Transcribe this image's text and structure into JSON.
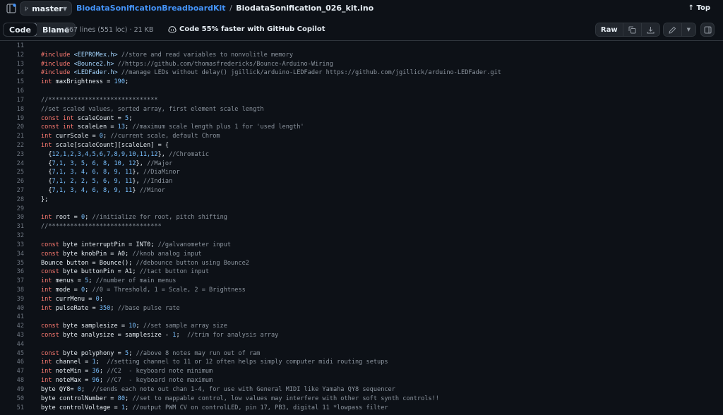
{
  "header": {
    "branch": "master",
    "repo": "BiodataSonificationBreadboardKit",
    "separator": "/",
    "file": "BiodataSonification_026_kit.ino",
    "top_label": "Top"
  },
  "toolbar": {
    "code_tab": "Code",
    "blame_tab": "Blame",
    "file_meta": "667 lines (551 loc) · 21 KB",
    "copilot_text": "Code 55% faster with GitHub Copilot",
    "raw_label": "Raw"
  },
  "code_lines": [
    {
      "n": "11",
      "t": []
    },
    {
      "n": "12",
      "t": [
        [
          "kw",
          "#include "
        ],
        [
          "str",
          "<EEPROMex.h>"
        ],
        [
          "com",
          " //store and read variables to nonvolitle memory"
        ]
      ]
    },
    {
      "n": "13",
      "t": [
        [
          "kw",
          "#include "
        ],
        [
          "str",
          "<Bounce2.h>"
        ],
        [
          "com",
          " //https://github.com/thomasfredericks/Bounce-Arduino-Wiring"
        ]
      ]
    },
    {
      "n": "14",
      "t": [
        [
          "kw",
          "#include "
        ],
        [
          "str",
          "<LEDFader.h>"
        ],
        [
          "com",
          " //manage LEDs without delay() jgillick/arduino-LEDFader https://github.com/jgillick/arduino-LEDFader.git"
        ]
      ]
    },
    {
      "n": "15",
      "t": [
        [
          "kw",
          "int"
        ],
        [
          "p",
          " maxBrightness = "
        ],
        [
          "num",
          "190"
        ],
        [
          "p",
          ";"
        ]
      ]
    },
    {
      "n": "16",
      "t": []
    },
    {
      "n": "17",
      "t": [
        [
          "com",
          "//******************************"
        ]
      ]
    },
    {
      "n": "18",
      "t": [
        [
          "com",
          "//set scaled values, sorted array, first element scale length"
        ]
      ]
    },
    {
      "n": "19",
      "t": [
        [
          "kw",
          "const int"
        ],
        [
          "p",
          " scaleCount = "
        ],
        [
          "num",
          "5"
        ],
        [
          "p",
          ";"
        ]
      ]
    },
    {
      "n": "20",
      "t": [
        [
          "kw",
          "const int"
        ],
        [
          "p",
          " scaleLen = "
        ],
        [
          "num",
          "13"
        ],
        [
          "p",
          "; "
        ],
        [
          "com",
          "//maximum scale length plus 1 for 'used length'"
        ]
      ]
    },
    {
      "n": "21",
      "t": [
        [
          "kw",
          "int"
        ],
        [
          "p",
          " currScale = "
        ],
        [
          "num",
          "0"
        ],
        [
          "p",
          "; "
        ],
        [
          "com",
          "//current scale, default Chrom"
        ]
      ]
    },
    {
      "n": "22",
      "t": [
        [
          "kw",
          "int"
        ],
        [
          "p",
          " scale[scaleCount][scaleLen] = {"
        ]
      ]
    },
    {
      "n": "23",
      "t": [
        [
          "p",
          "  {"
        ],
        [
          "num",
          "12,1,2,3,4,5,6,7,8,9,10,11,12"
        ],
        [
          "p",
          "}, "
        ],
        [
          "com",
          "//Chromatic"
        ]
      ]
    },
    {
      "n": "24",
      "t": [
        [
          "p",
          "  {"
        ],
        [
          "num",
          "7,1, 3, 5, 6, 8, 10, 12"
        ],
        [
          "p",
          "}, "
        ],
        [
          "com",
          "//Major"
        ]
      ]
    },
    {
      "n": "25",
      "t": [
        [
          "p",
          "  {"
        ],
        [
          "num",
          "7,1, 3, 4, 6, 8, 9, 11"
        ],
        [
          "p",
          "}, "
        ],
        [
          "com",
          "//DiaMinor"
        ]
      ]
    },
    {
      "n": "26",
      "t": [
        [
          "p",
          "  {"
        ],
        [
          "num",
          "7,1, 2, 2, 5, 6, 9, 11"
        ],
        [
          "p",
          "}, "
        ],
        [
          "com",
          "//Indian"
        ]
      ]
    },
    {
      "n": "27",
      "t": [
        [
          "p",
          "  {"
        ],
        [
          "num",
          "7,1, 3, 4, 6, 8, 9, 11"
        ],
        [
          "p",
          "} "
        ],
        [
          "com",
          "//Minor"
        ]
      ]
    },
    {
      "n": "28",
      "t": [
        [
          "p",
          "};"
        ]
      ]
    },
    {
      "n": "29",
      "t": []
    },
    {
      "n": "30",
      "t": [
        [
          "kw",
          "int"
        ],
        [
          "p",
          " root = "
        ],
        [
          "num",
          "0"
        ],
        [
          "p",
          "; "
        ],
        [
          "com",
          "//initialize for root, pitch shifting"
        ]
      ]
    },
    {
      "n": "31",
      "t": [
        [
          "com",
          "//*******************************"
        ]
      ]
    },
    {
      "n": "32",
      "t": []
    },
    {
      "n": "33",
      "t": [
        [
          "kw",
          "const"
        ],
        [
          "p",
          " byte interruptPin = INT0; "
        ],
        [
          "com",
          "//galvanometer input"
        ]
      ]
    },
    {
      "n": "34",
      "t": [
        [
          "kw",
          "const"
        ],
        [
          "p",
          " byte knobPin = A0; "
        ],
        [
          "com",
          "//knob analog input"
        ]
      ]
    },
    {
      "n": "35",
      "t": [
        [
          "p",
          "Bounce button = Bounce(); "
        ],
        [
          "com",
          "//debounce button using Bounce2"
        ]
      ]
    },
    {
      "n": "36",
      "t": [
        [
          "kw",
          "const"
        ],
        [
          "p",
          " byte buttonPin = A1; "
        ],
        [
          "com",
          "//tact button input"
        ]
      ]
    },
    {
      "n": "37",
      "t": [
        [
          "kw",
          "int"
        ],
        [
          "p",
          " menus = "
        ],
        [
          "num",
          "5"
        ],
        [
          "p",
          "; "
        ],
        [
          "com",
          "//number of main menus"
        ]
      ]
    },
    {
      "n": "38",
      "t": [
        [
          "kw",
          "int"
        ],
        [
          "p",
          " mode = "
        ],
        [
          "num",
          "0"
        ],
        [
          "p",
          "; "
        ],
        [
          "com",
          "//0 = Threshold, 1 = Scale, 2 = Brightness"
        ]
      ]
    },
    {
      "n": "39",
      "t": [
        [
          "kw",
          "int"
        ],
        [
          "p",
          " currMenu = "
        ],
        [
          "num",
          "0"
        ],
        [
          "p",
          ";"
        ]
      ]
    },
    {
      "n": "40",
      "t": [
        [
          "kw",
          "int"
        ],
        [
          "p",
          " pulseRate = "
        ],
        [
          "num",
          "350"
        ],
        [
          "p",
          "; "
        ],
        [
          "com",
          "//base pulse rate"
        ]
      ]
    },
    {
      "n": "41",
      "t": []
    },
    {
      "n": "42",
      "t": [
        [
          "kw",
          "const"
        ],
        [
          "p",
          " byte samplesize = "
        ],
        [
          "num",
          "10"
        ],
        [
          "p",
          "; "
        ],
        [
          "com",
          "//set sample array size"
        ]
      ]
    },
    {
      "n": "43",
      "t": [
        [
          "kw",
          "const"
        ],
        [
          "p",
          " byte analysize = samplesize - "
        ],
        [
          "num",
          "1"
        ],
        [
          "p",
          ";  "
        ],
        [
          "com",
          "//trim for analysis array"
        ]
      ]
    },
    {
      "n": "44",
      "t": []
    },
    {
      "n": "45",
      "t": [
        [
          "kw",
          "const"
        ],
        [
          "p",
          " byte polyphony = "
        ],
        [
          "num",
          "5"
        ],
        [
          "p",
          "; "
        ],
        [
          "com",
          "//above 8 notes may run out of ram"
        ]
      ]
    },
    {
      "n": "46",
      "t": [
        [
          "kw",
          "int"
        ],
        [
          "p",
          " channel = "
        ],
        [
          "num",
          "1"
        ],
        [
          "p",
          ";  "
        ],
        [
          "com",
          "//setting channel to 11 or 12 often helps simply computer midi routing setups"
        ]
      ]
    },
    {
      "n": "47",
      "t": [
        [
          "kw",
          "int"
        ],
        [
          "p",
          " noteMin = "
        ],
        [
          "num",
          "36"
        ],
        [
          "p",
          "; "
        ],
        [
          "com",
          "//C2  - keyboard note minimum"
        ]
      ]
    },
    {
      "n": "48",
      "t": [
        [
          "kw",
          "int"
        ],
        [
          "p",
          " noteMax = "
        ],
        [
          "num",
          "96"
        ],
        [
          "p",
          "; "
        ],
        [
          "com",
          "//C7  - keyboard note maximum"
        ]
      ]
    },
    {
      "n": "49",
      "t": [
        [
          "p",
          "byte QY8= "
        ],
        [
          "num",
          "0"
        ],
        [
          "p",
          ";  "
        ],
        [
          "com",
          "//sends each note out chan 1-4, for use with General MIDI like Yamaha QY8 sequencer"
        ]
      ]
    },
    {
      "n": "50",
      "t": [
        [
          "p",
          "byte controlNumber = "
        ],
        [
          "num",
          "80"
        ],
        [
          "p",
          "; "
        ],
        [
          "com",
          "//set to mappable control, low values may interfere with other soft synth controls!!"
        ]
      ]
    },
    {
      "n": "51",
      "t": [
        [
          "p",
          "byte controlVoltage = "
        ],
        [
          "num",
          "1"
        ],
        [
          "p",
          "; "
        ],
        [
          "com",
          "//output PWM CV on controlLED, pin 17, PB3, digital 11 *lowpass filter"
        ]
      ]
    }
  ]
}
